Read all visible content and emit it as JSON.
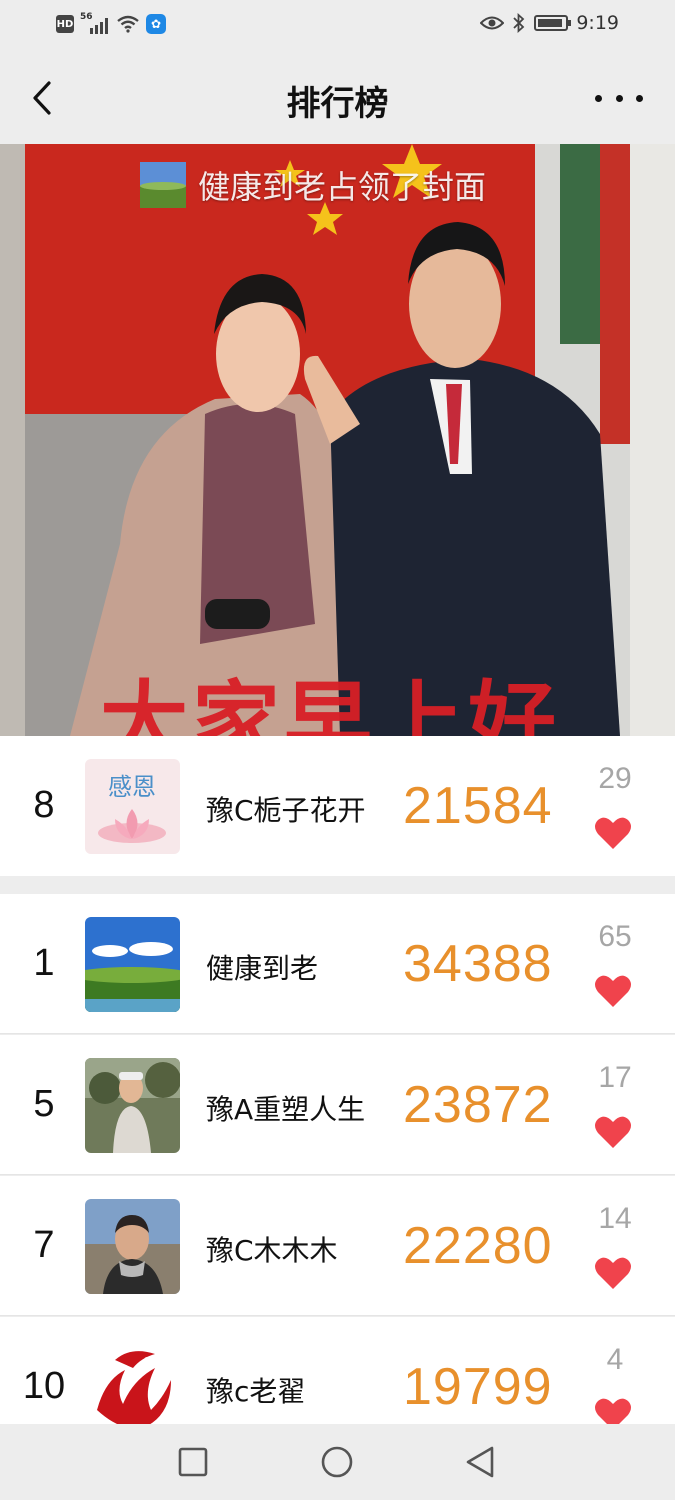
{
  "status_bar": {
    "network_badge": "HD",
    "network_type": "56",
    "time": "9:19",
    "icons": [
      "hd-icon",
      "signal-icon",
      "wifi-icon",
      "app-notification-icon",
      "eye-icon",
      "bluetooth-icon",
      "battery-icon"
    ]
  },
  "header": {
    "title": "排行榜",
    "back_icon": "chevron-left-icon",
    "more_icon": "more-dots-icon"
  },
  "cover": {
    "caption": "健康到老占领了封面",
    "greeting": "大家早上好"
  },
  "my_entry": {
    "rank": "8",
    "name": "豫C栀子花开",
    "avatar_text": "感恩",
    "steps": "21584",
    "likes": "29"
  },
  "leaderboard": [
    {
      "rank": "1",
      "name": "健康到老",
      "steps": "34388",
      "likes": "65"
    },
    {
      "rank": "5",
      "name": "豫A重塑人生",
      "steps": "23872",
      "likes": "17"
    },
    {
      "rank": "7",
      "name": "豫C木木木",
      "steps": "22280",
      "likes": "14"
    },
    {
      "rank": "10",
      "name": "豫c老翟",
      "steps": "19799",
      "likes": "4"
    }
  ],
  "colors": {
    "steps": "#e8902c",
    "heart": "#f0434c",
    "likes_count": "#a6a6a6",
    "background": "#ededed"
  },
  "system_nav": [
    "square-icon",
    "circle-icon",
    "triangle-back-icon"
  ]
}
